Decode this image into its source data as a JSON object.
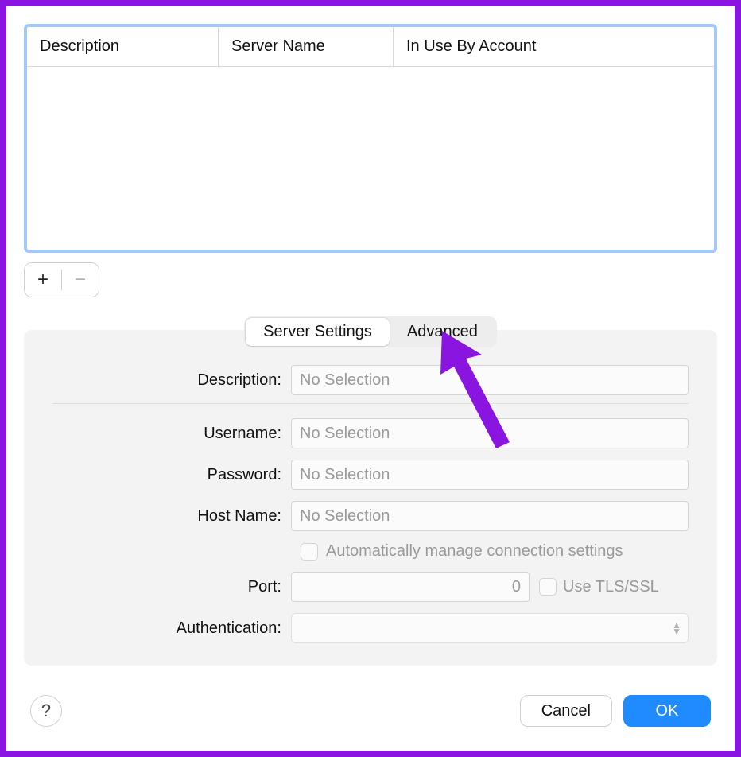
{
  "table": {
    "columns": [
      "Description",
      "Server Name",
      "In Use By Account"
    ]
  },
  "controls": {
    "add": "+",
    "remove": "−"
  },
  "tabs": {
    "server_settings": "Server Settings",
    "advanced": "Advanced"
  },
  "form": {
    "description_label": "Description:",
    "description_placeholder": "No Selection",
    "username_label": "Username:",
    "username_placeholder": "No Selection",
    "password_label": "Password:",
    "password_placeholder": "No Selection",
    "hostname_label": "Host Name:",
    "hostname_placeholder": "No Selection",
    "auto_manage_label": "Automatically manage connection settings",
    "port_label": "Port:",
    "port_value": "0",
    "tls_label": "Use TLS/SSL",
    "authentication_label": "Authentication:"
  },
  "footer": {
    "help": "?",
    "cancel": "Cancel",
    "ok": "OK"
  }
}
